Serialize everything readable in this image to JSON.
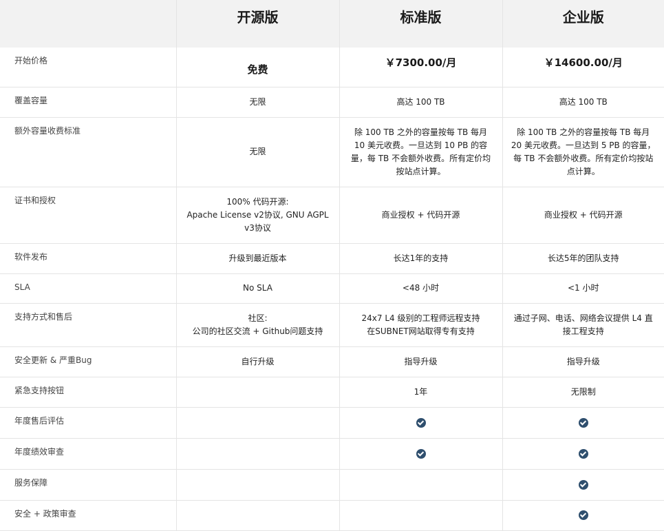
{
  "headers": [
    "",
    "开源版",
    "标准版",
    "企业版"
  ],
  "rows": [
    {
      "label": "开始价格",
      "cells": [
        "免费",
        "￥7300.00/月",
        "￥14600.00/月"
      ]
    },
    {
      "label": "覆盖容量",
      "cells": [
        "无限",
        "高达 100 TB",
        "高达 100 TB"
      ]
    },
    {
      "label": "额外容量收费标准",
      "cells": [
        "无限",
        "除 100 TB 之外的容量按每 TB 每月 10 美元收费。一旦达到 10 PB 的容量，每 TB 不会额外收费。所有定价均按站点计算。",
        "除 100 TB 之外的容量按每 TB 每月 20 美元收费。一旦达到 5 PB 的容量，每 TB 不会额外收费。所有定价均按站点计算。"
      ]
    },
    {
      "label": "证书和授权",
      "cells": [
        "100% 代码开源:\nApache License v2协议, GNU AGPL v3协议",
        "商业授权 + 代码开源",
        "商业授权 + 代码开源"
      ]
    },
    {
      "label": "软件发布",
      "cells": [
        "升级到最近版本",
        "长达1年的支持",
        "长达5年的团队支持"
      ]
    },
    {
      "label": "SLA",
      "cells": [
        "No SLA",
        "<48 小时",
        "<1 小时"
      ]
    },
    {
      "label": "支持方式和售后",
      "cells": [
        "社区:\n公司的社区交流 + Github问题支持",
        "24x7 L4 级别的工程师远程支持\n在SUBNET网站取得专有支持",
        "通过子网、电话、网络会议提供 L4 直接工程支持"
      ]
    },
    {
      "label": "安全更新 & 严重Bug",
      "cells": [
        "自行升级",
        "指导升级",
        "指导升级"
      ]
    },
    {
      "label": "紧急支持按钮",
      "cells": [
        "",
        "1年",
        "无限制"
      ]
    },
    {
      "label": "年度售后评估",
      "checks": [
        false,
        true,
        true
      ]
    },
    {
      "label": "年度绩效审查",
      "checks": [
        false,
        true,
        true
      ]
    },
    {
      "label": "服务保障",
      "checks": [
        false,
        false,
        true
      ]
    },
    {
      "label": "安全 + 政策审查",
      "checks": [
        false,
        false,
        true
      ]
    }
  ]
}
